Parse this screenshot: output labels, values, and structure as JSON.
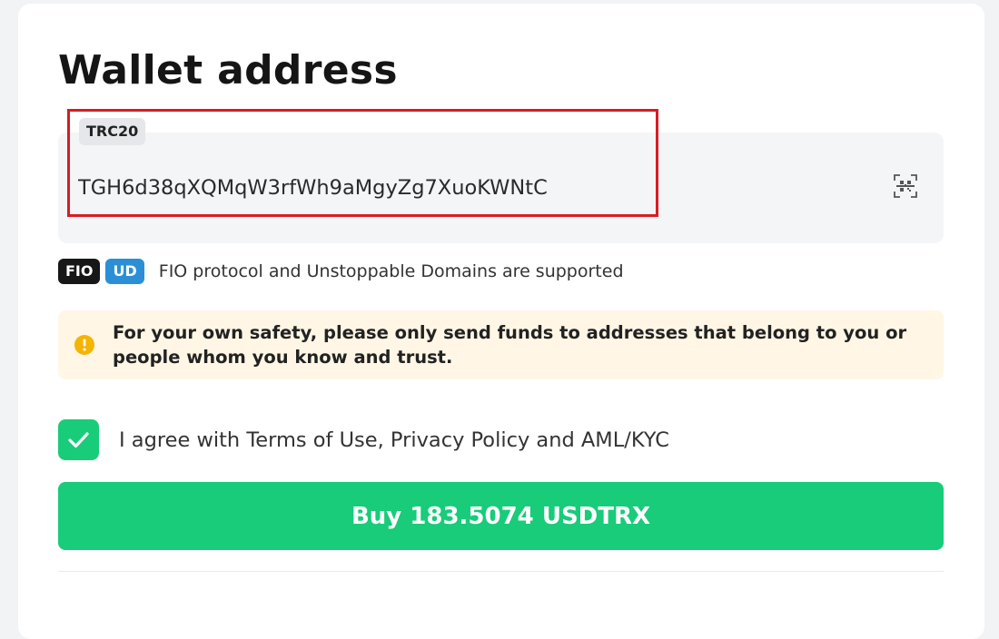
{
  "page": {
    "title": "Wallet address"
  },
  "address": {
    "network": "TRC20",
    "value": "TGH6d38qXQMqW3rfWh9aMgyZg7XuoKWNtC",
    "scan_icon": "qr-scan-icon"
  },
  "naming_services": {
    "fio_tag": "FIO",
    "ud_tag": "UD",
    "text": "FIO protocol and Unstoppable Domains are supported",
    "ud_color": "#2a8fd6"
  },
  "warning": {
    "icon": "warning-icon",
    "color": "#f5b400",
    "text": "For your own safety, please only send funds to addresses that belong to you or people whom you know and trust."
  },
  "agreement": {
    "checked": true,
    "text": "I agree with Terms of Use, Privacy Policy and AML/KYC"
  },
  "buy_button": {
    "label": "Buy 183.5074 USDTRX",
    "color": "#18cc79"
  },
  "annotation": {
    "highlight_color": "#d81c23"
  }
}
